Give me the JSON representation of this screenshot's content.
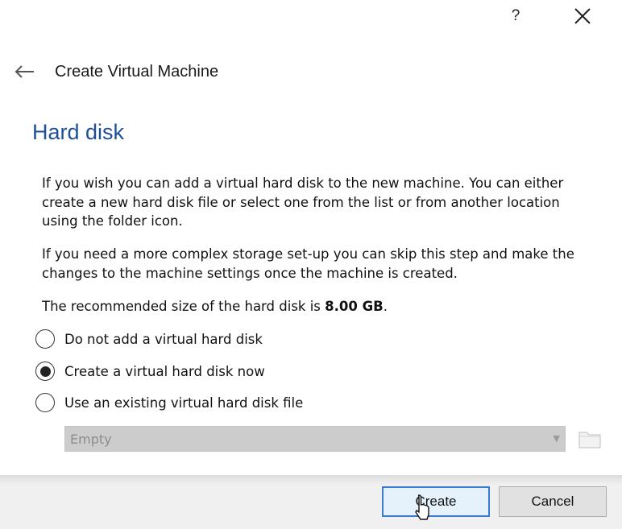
{
  "titlebar": {
    "help_label": "?",
    "close_icon": "close-icon"
  },
  "header": {
    "back_icon": "arrow-left-icon",
    "title": "Create Virtual Machine"
  },
  "page": {
    "heading": "Hard disk",
    "paragraph1": "If you wish you can add a virtual hard disk to the new machine. You can either create a new hard disk file or select one from the list or from another location using the folder icon.",
    "paragraph2": "If you need a more complex storage set-up you can skip this step and make the changes to the machine settings once the machine is created.",
    "recommended_prefix": "The recommended size of the hard disk is ",
    "recommended_size": "8.00 GB",
    "recommended_suffix": "."
  },
  "options": [
    {
      "label": "Do not add a virtual hard disk",
      "selected": false
    },
    {
      "label": "Create a virtual hard disk now",
      "selected": true
    },
    {
      "label": "Use an existing virtual hard disk file",
      "selected": false
    }
  ],
  "disk_combo": {
    "value": "Empty",
    "enabled": false,
    "icon": "chevron-down-icon"
  },
  "folder_button": {
    "icon": "folder-icon",
    "enabled": false
  },
  "buttons": {
    "create": "Create",
    "cancel": "Cancel"
  }
}
